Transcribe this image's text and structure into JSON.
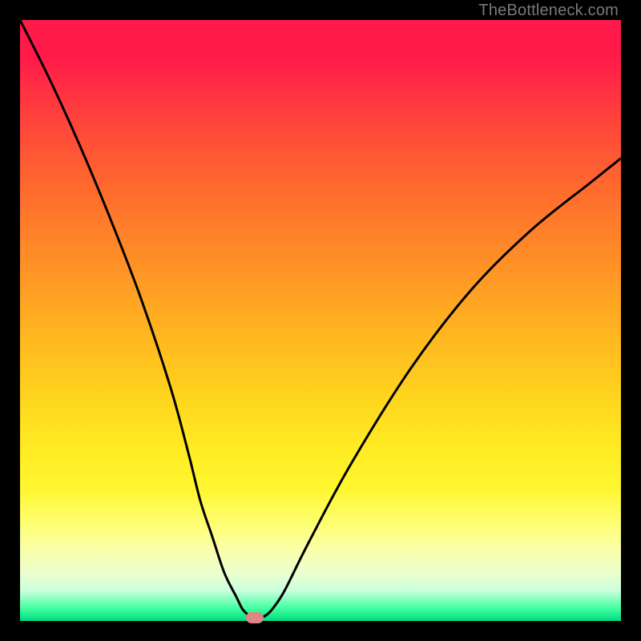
{
  "watermark": "TheBottleneck.com",
  "colors": {
    "page_bg": "#000000",
    "curve": "#000000",
    "marker": "#e08585",
    "watermark": "#7a7a7a"
  },
  "chart_data": {
    "type": "line",
    "title": "",
    "xlabel": "",
    "ylabel": "",
    "xlim": [
      0,
      100
    ],
    "ylim": [
      0,
      100
    ],
    "grid": false,
    "legend": false,
    "background_gradient": [
      "#ff1a4a",
      "#ff8f26",
      "#ffed24",
      "#00d980"
    ],
    "series": [
      {
        "name": "bottleneck-curve",
        "x": [
          0,
          5,
          10,
          15,
          20,
          25,
          28,
          30,
          32,
          34,
          36,
          37,
          38,
          39,
          40,
          41,
          42,
          44,
          48,
          55,
          65,
          75,
          85,
          95,
          100
        ],
        "y": [
          100,
          90,
          79,
          67,
          54,
          39,
          28,
          20,
          14,
          8,
          4,
          2,
          1,
          0.5,
          0.5,
          1,
          2,
          5,
          13,
          26,
          42,
          55,
          65,
          73,
          77
        ]
      }
    ],
    "marker": {
      "x": 39,
      "y": 0.5,
      "shape": "pill",
      "color": "#e08585"
    }
  }
}
